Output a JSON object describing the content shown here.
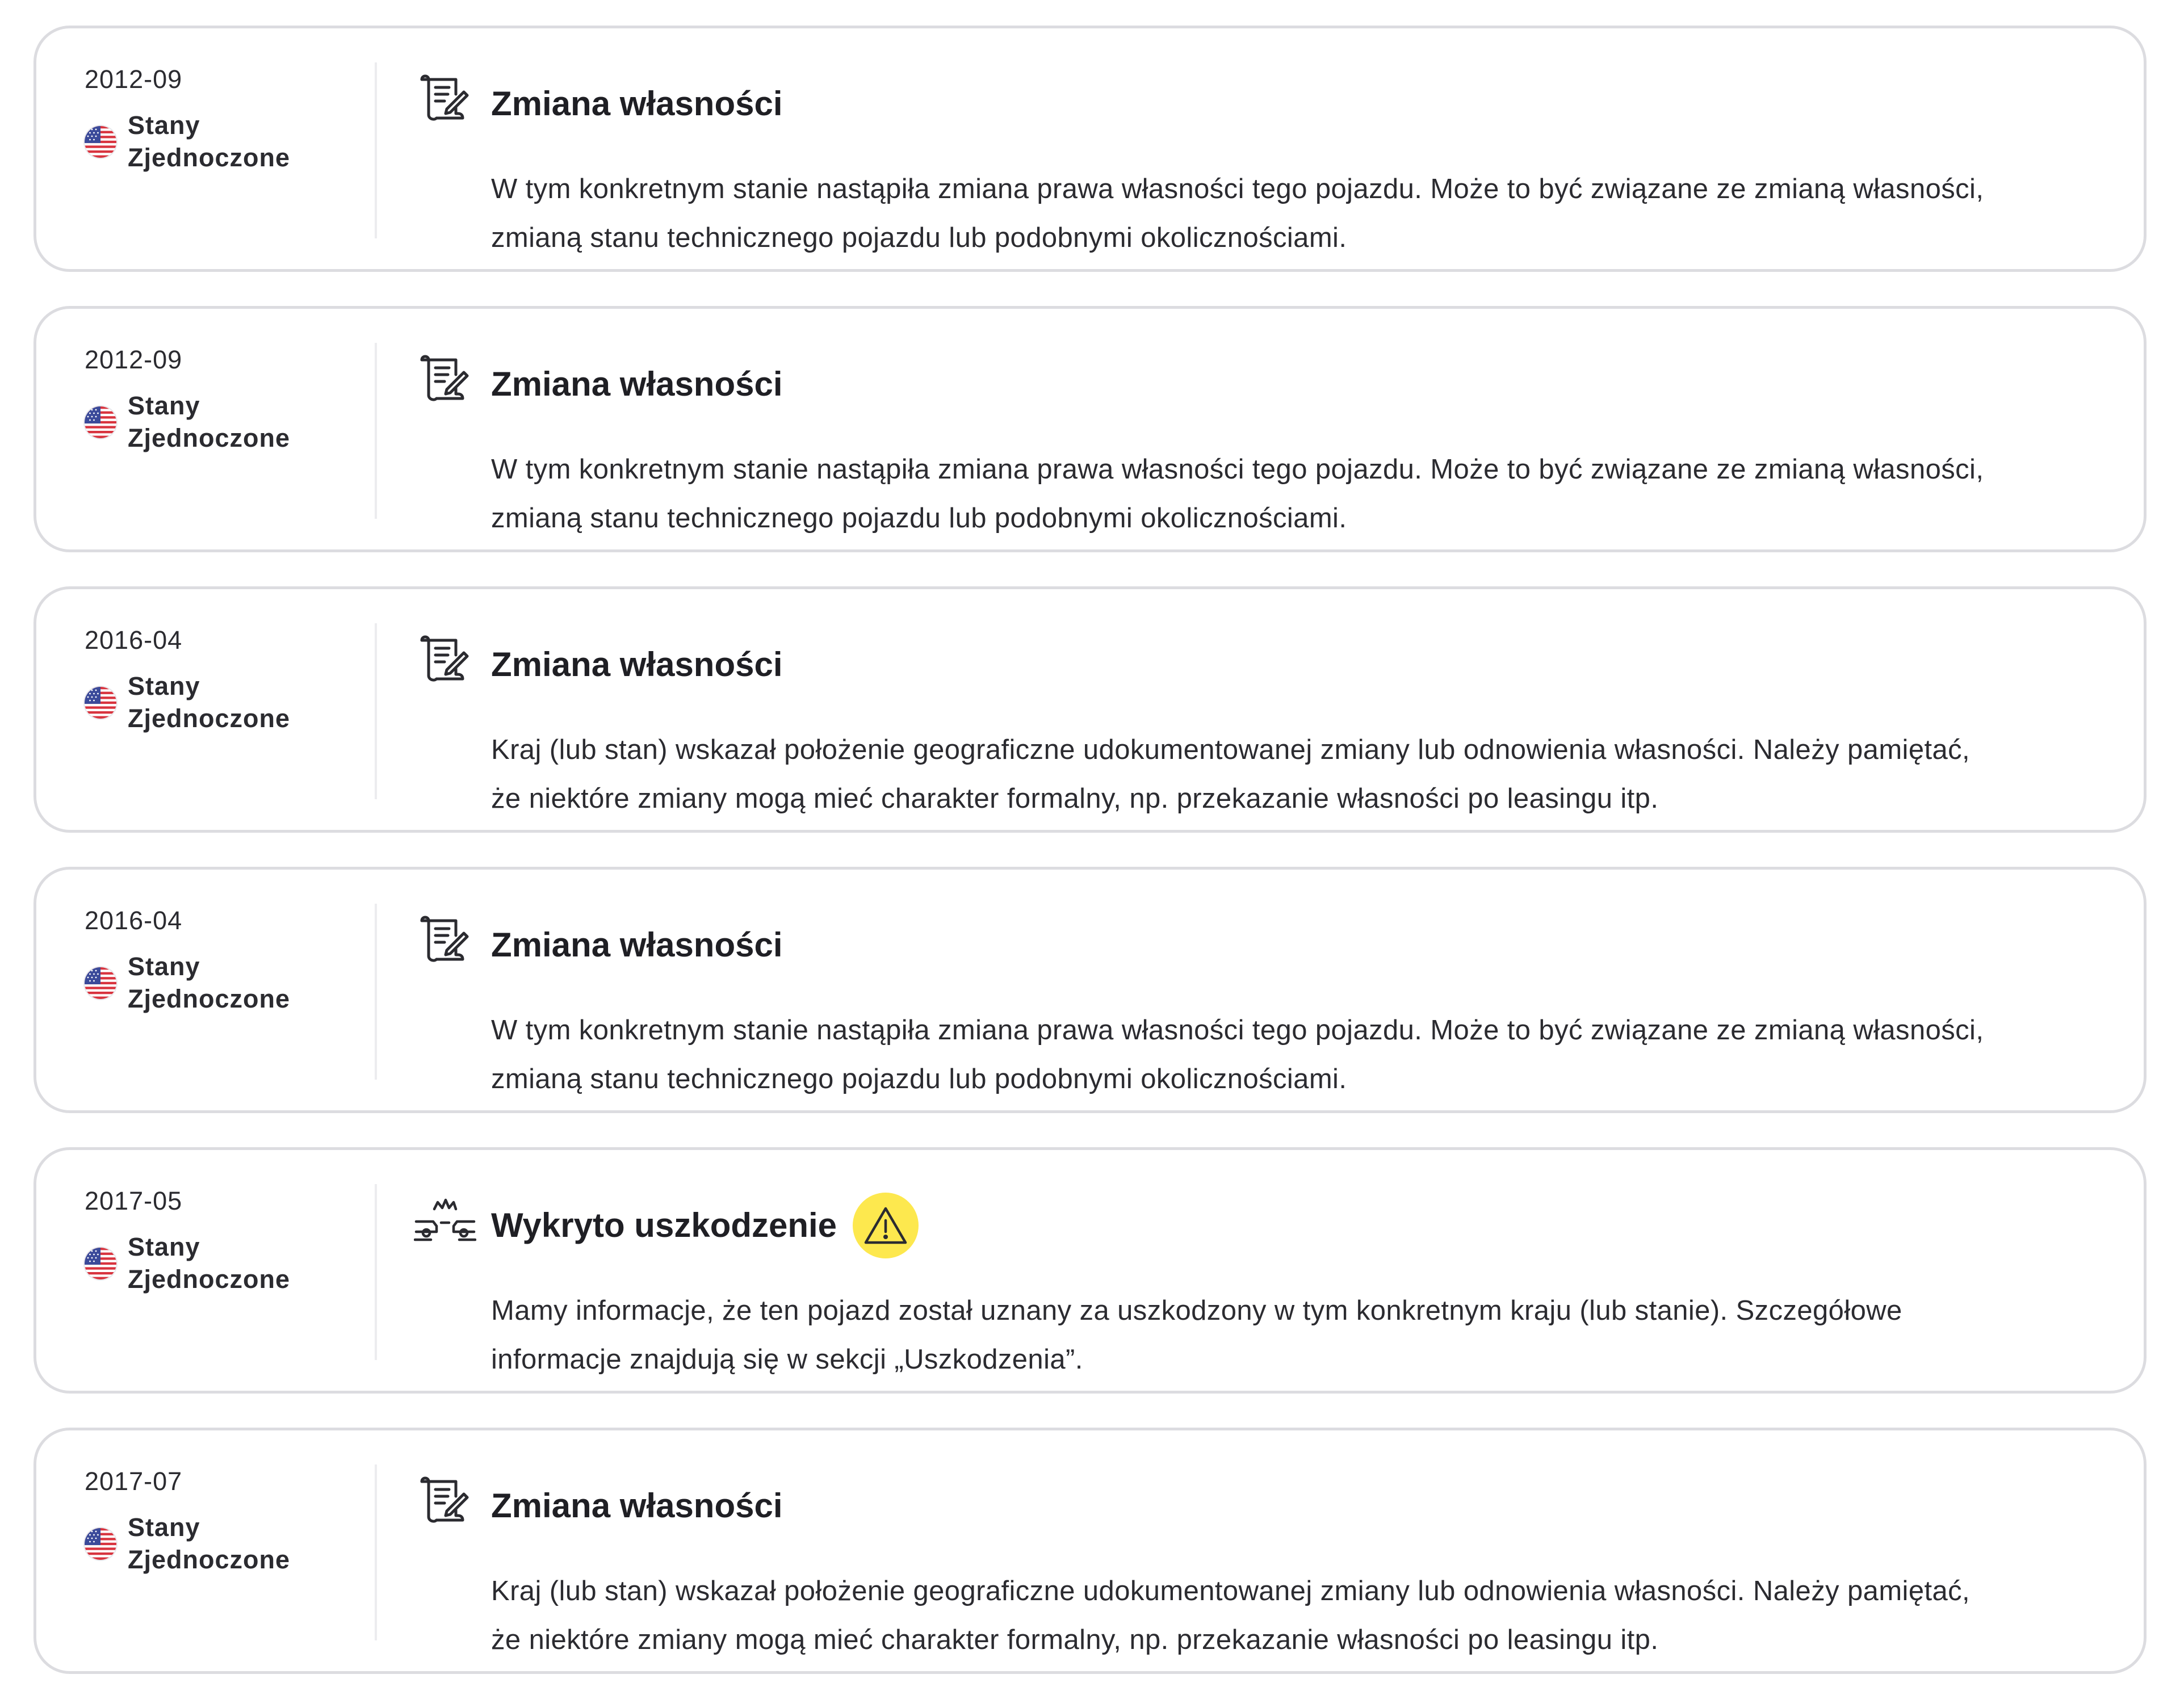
{
  "events": [
    {
      "date": "2012-09",
      "country": [
        "Stany",
        "Zjednoczone"
      ],
      "icon": "ownership-document-icon",
      "title": "Zmiana własności",
      "warning": false,
      "description": [
        "W tym konkretnym stanie nastąpiła zmiana prawa własności tego pojazdu. Może to być związane ze zmianą własności,",
        "zmianą stanu technicznego pojazdu lub podobnymi okolicznościami."
      ]
    },
    {
      "date": "2012-09",
      "country": [
        "Stany",
        "Zjednoczone"
      ],
      "icon": "ownership-document-icon",
      "title": "Zmiana własności",
      "warning": false,
      "description": [
        "W tym konkretnym stanie nastąpiła zmiana prawa własności tego pojazdu. Może to być związane ze zmianą własności,",
        "zmianą stanu technicznego pojazdu lub podobnymi okolicznościami."
      ]
    },
    {
      "date": "2016-04",
      "country": [
        "Stany",
        "Zjednoczone"
      ],
      "icon": "ownership-document-icon",
      "title": "Zmiana własności",
      "warning": false,
      "description": [
        "Kraj (lub stan) wskazał położenie geograficzne udokumentowanej zmiany lub odnowienia własności. Należy pamiętać,",
        "że niektóre zmiany mogą mieć charakter formalny, np. przekazanie własności po leasingu itp."
      ]
    },
    {
      "date": "2016-04",
      "country": [
        "Stany",
        "Zjednoczone"
      ],
      "icon": "ownership-document-icon",
      "title": "Zmiana własności",
      "warning": false,
      "description": [
        "W tym konkretnym stanie nastąpiła zmiana prawa własności tego pojazdu. Może to być związane ze zmianą własności,",
        "zmianą stanu technicznego pojazdu lub podobnymi okolicznościami."
      ]
    },
    {
      "date": "2017-05",
      "country": [
        "Stany",
        "Zjednoczone"
      ],
      "icon": "car-crash-icon",
      "title": "Wykryto uszkodzenie",
      "warning": true,
      "description": [
        "Mamy informacje, że ten pojazd został uznany za uszkodzony w tym konkretnym kraju (lub stanie). Szczegółowe",
        "informacje znajdują się w sekcji „Uszkodzenia”."
      ]
    },
    {
      "date": "2017-07",
      "country": [
        "Stany",
        "Zjednoczone"
      ],
      "icon": "ownership-document-icon",
      "title": "Zmiana własności",
      "warning": false,
      "description": [
        "Kraj (lub stan) wskazał położenie geograficzne udokumentowanej zmiany lub odnowienia własności. Należy pamiętać,",
        "że niektóre zmiany mogą mieć charakter formalny, np. przekazanie własności po leasingu itp."
      ]
    }
  ],
  "colors": {
    "card_border": "#dcdce0",
    "divider": "#ececef",
    "warning_badge": "#fde84e",
    "text": "#1f1f24"
  }
}
